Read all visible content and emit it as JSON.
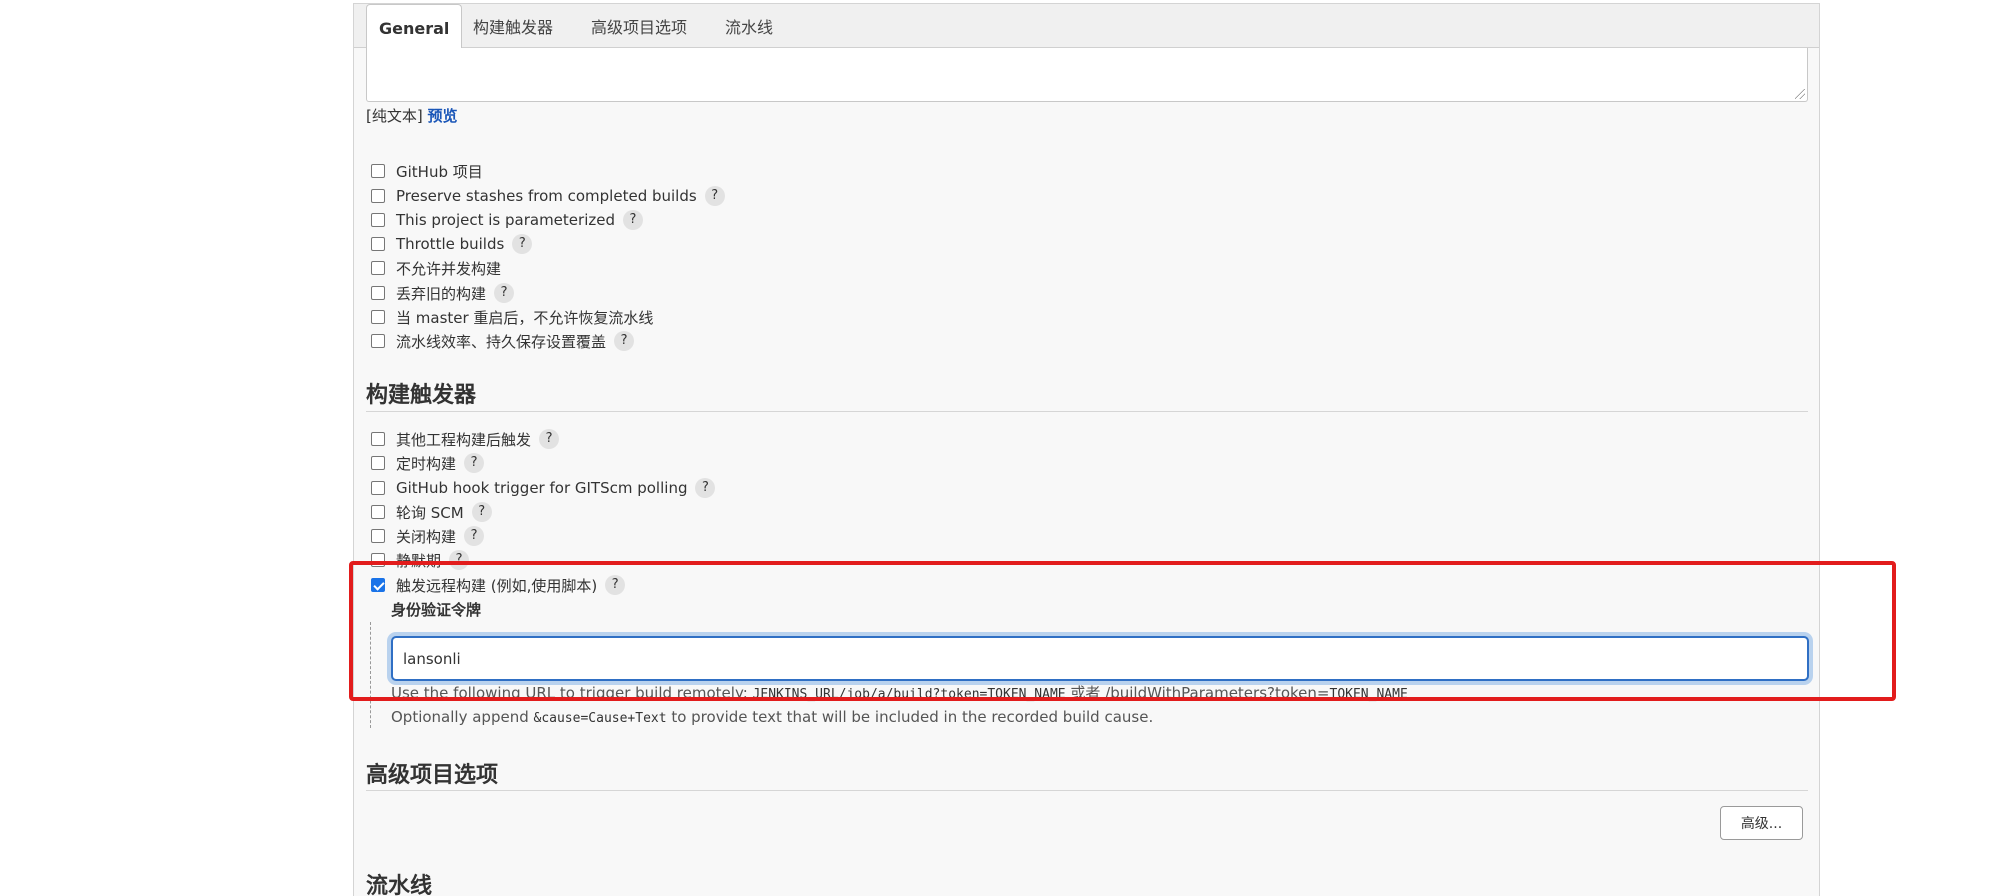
{
  "tabs": [
    {
      "label": "General",
      "active": true
    },
    {
      "label": "构建触发器",
      "active": false
    },
    {
      "label": "高级项目选项",
      "active": false
    },
    {
      "label": "流水线",
      "active": false
    }
  ],
  "description": {
    "value": "",
    "plain_text_label": "[纯文本]",
    "preview_link": "预览"
  },
  "general_options": [
    {
      "label": "GitHub 项目",
      "checked": false,
      "help": false
    },
    {
      "label": "Preserve stashes from completed builds",
      "checked": false,
      "help": true
    },
    {
      "label": "This project is parameterized",
      "checked": false,
      "help": true
    },
    {
      "label": "Throttle builds",
      "checked": false,
      "help": true
    },
    {
      "label": "不允许并发构建",
      "checked": false,
      "help": false
    },
    {
      "label": "丢弃旧的构建",
      "checked": false,
      "help": true
    },
    {
      "label": "当 master 重启后，不允许恢复流水线",
      "checked": false,
      "help": false
    },
    {
      "label": "流水线效率、持久保存设置覆盖",
      "checked": false,
      "help": true
    }
  ],
  "build_triggers": {
    "title": "构建触发器",
    "options": [
      {
        "label": "其他工程构建后触发",
        "checked": false,
        "help": true
      },
      {
        "label": "定时构建",
        "checked": false,
        "help": true
      },
      {
        "label": "GitHub hook trigger for GITScm polling",
        "checked": false,
        "help": true
      },
      {
        "label": "轮询 SCM",
        "checked": false,
        "help": true
      },
      {
        "label": "关闭构建",
        "checked": false,
        "help": true
      },
      {
        "label": "静默期",
        "checked": false,
        "help": true
      },
      {
        "label": "触发远程构建 (例如,使用脚本)",
        "checked": true,
        "help": true
      }
    ],
    "auth_token": {
      "label": "身份验证令牌",
      "value": "lansonli"
    },
    "info_line1": {
      "prefix": "Use the following URL to trigger build remotely: ",
      "code1": "JENKINS_URL/job/a/build?token=TOKEN_NAME",
      "middle": " 或者 /buildWithParameters?token=",
      "code2": "TOKEN_NAME"
    },
    "info_line2": {
      "prefix": "Optionally append ",
      "code": "&cause=Cause+Text",
      "suffix": " to provide text that will be included in the recorded build cause."
    }
  },
  "advanced_options": {
    "title": "高级项目选项",
    "button_label": "高级..."
  },
  "pipeline": {
    "title": "流水线"
  },
  "help_glyph": "?",
  "colors": {
    "highlight": "#e21c1c",
    "link": "#1a56b8",
    "input_focus": "#2f6fc4",
    "checkbox_checked": "#1a73e8"
  }
}
